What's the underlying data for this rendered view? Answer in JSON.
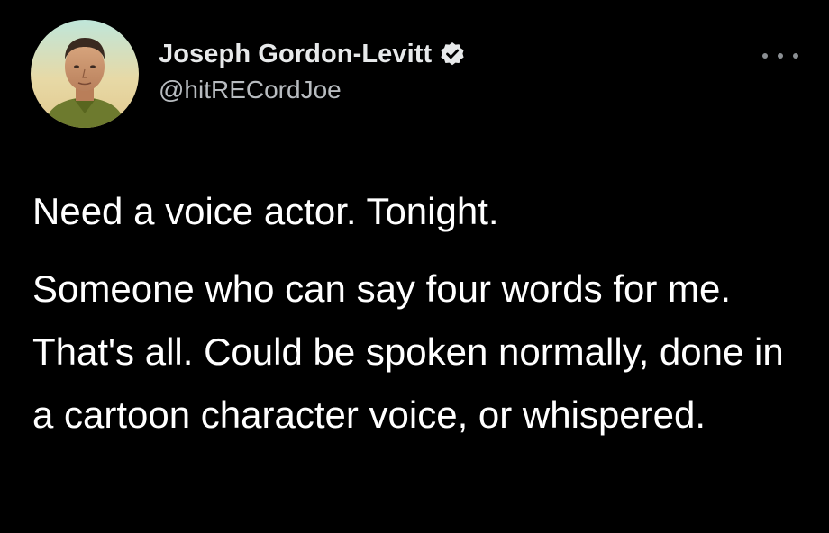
{
  "author": {
    "display_name": "Joseph Gordon-Levitt",
    "handle": "@hitRECordJoe",
    "verified": true,
    "avatar_icon": "profile-photo"
  },
  "tweet": {
    "paragraphs": [
      "Need a voice actor. Tonight.",
      "Someone who can say four words for me. That's all. Could be spoken normally, done in a cartoon character voice, or whispered."
    ]
  },
  "menu": {
    "icon": "more-options-icon"
  },
  "colors": {
    "background": "#000000",
    "text": "#ffffff",
    "secondary_text": "#b8bcc0",
    "verified_badge": "#e7e9ea"
  }
}
